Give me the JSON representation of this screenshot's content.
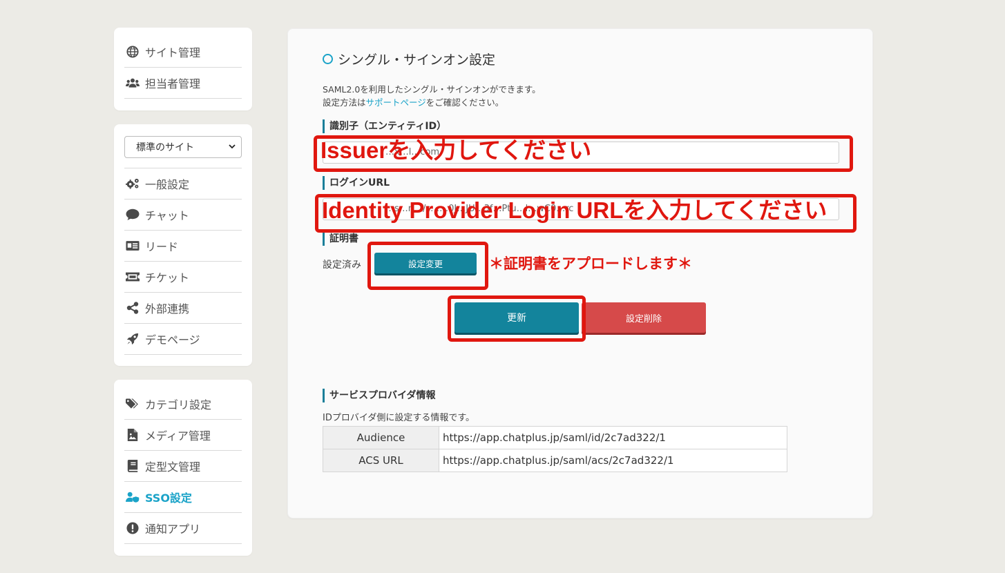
{
  "sidebar": {
    "group1": [
      {
        "label": "サイト管理",
        "icon": "globe-icon"
      },
      {
        "label": "担当者管理",
        "icon": "users-icon"
      }
    ],
    "site_select": {
      "value": "標準のサイト"
    },
    "group2": [
      {
        "label": "一般設定",
        "icon": "gears-icon"
      },
      {
        "label": "チャット",
        "icon": "chat-bubble-icon"
      },
      {
        "label": "リード",
        "icon": "id-card-icon"
      },
      {
        "label": "チケット",
        "icon": "ticket-icon"
      },
      {
        "label": "外部連携",
        "icon": "share-icon"
      },
      {
        "label": "デモページ",
        "icon": "rocket-icon"
      }
    ],
    "group3": [
      {
        "label": "カテゴリ設定",
        "icon": "tags-icon"
      },
      {
        "label": "メディア管理",
        "icon": "image-file-icon"
      },
      {
        "label": "定型文管理",
        "icon": "book-icon"
      },
      {
        "label": "SSO設定",
        "icon": "user-shield-icon",
        "active": true
      },
      {
        "label": "通知アプリ",
        "icon": "exclamation-circle-icon"
      }
    ]
  },
  "main": {
    "title": "シングル・サインオン設定",
    "desc_line1": "SAML2.0を利用したシングル・サインオンができます。",
    "desc_line2_prefix": "設定方法は",
    "desc_line2_link": "サポートページ",
    "desc_line2_suffix": "をご確認ください。",
    "entity_label": "識別子（エンティティID）",
    "entity_value": "…x…l…com",
    "login_label": "ログインURL",
    "login_value": "…s…n…/s……0J…JU…3f…Ptu…l…wC0…rc",
    "cert_label": "証明書",
    "cert_status": "設定済み",
    "cert_change_btn": "設定変更",
    "update_btn": "更新",
    "delete_btn": "設定削除",
    "sp_label": "サービスプロバイダ情報",
    "sp_desc": "IDプロバイダ側に設定する情報です。",
    "sp_rows": [
      {
        "key": "Audience",
        "value": "https://app.chatplus.jp/saml/id/2c7ad322/1"
      },
      {
        "key": "ACS URL",
        "value": "https://app.chatplus.jp/saml/acs/2c7ad322/1"
      }
    ]
  },
  "annotations": {
    "issuer": "Issuerを入力してください",
    "login_url": "Identity Provider Login URLを入力してください",
    "cert": "＊証明書をアプロードします＊"
  },
  "colors": {
    "accent": "#1aa3c8",
    "teal_button": "#13849c",
    "red_button": "#d64a4a",
    "annotation_red": "#e0170f"
  }
}
